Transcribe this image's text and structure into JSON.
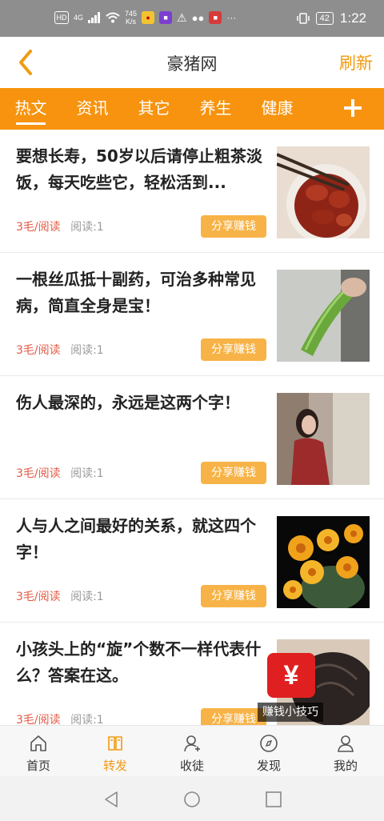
{
  "status_bar": {
    "network": "4G",
    "speed_value": "745",
    "speed_unit": "K/s",
    "battery": "42",
    "time": "1:22"
  },
  "header": {
    "title": "豪猪网",
    "refresh_label": "刷新"
  },
  "tabs": [
    {
      "label": "热文",
      "active": true
    },
    {
      "label": "资讯"
    },
    {
      "label": "其它"
    },
    {
      "label": "养生"
    },
    {
      "label": "健康"
    }
  ],
  "articles": [
    {
      "title": "要想长寿，50岁以后请停止粗茶淡饭，每天吃些它，轻松活到...",
      "reward": "3毛/阅读",
      "reads": "阅读:1",
      "share_label": "分享赚钱"
    },
    {
      "title": "一根丝瓜抵十副药，可治多种常见病，简直全身是宝！",
      "reward": "3毛/阅读",
      "reads": "阅读:1",
      "share_label": "分享赚钱"
    },
    {
      "title": "伤人最深的，永远是这两个字！",
      "reward": "3毛/阅读",
      "reads": "阅读:1",
      "share_label": "分享赚钱"
    },
    {
      "title": "人与人之间最好的关系，就这四个字！",
      "reward": "3毛/阅读",
      "reads": "阅读:1",
      "share_label": "分享赚钱"
    },
    {
      "title": "小孩头上的“旋”个数不一样代表什么？答案在这。",
      "reward": "3毛/阅读",
      "reads": "阅读:1",
      "share_label": "分享赚钱"
    }
  ],
  "overlay": {
    "badge_symbol": "¥",
    "label": "赚钱小技巧"
  },
  "bottom_nav": [
    {
      "label": "首页",
      "icon": "home-icon"
    },
    {
      "label": "转发",
      "icon": "book-icon",
      "active": true
    },
    {
      "label": "收徒",
      "icon": "add-user-icon"
    },
    {
      "label": "发现",
      "icon": "compass-icon"
    },
    {
      "label": "我的",
      "icon": "user-icon"
    }
  ],
  "colors": {
    "accent": "#f7930e",
    "share_button": "#f7b347",
    "reward_text": "#e35b47",
    "active_nav": "#f19a12"
  }
}
